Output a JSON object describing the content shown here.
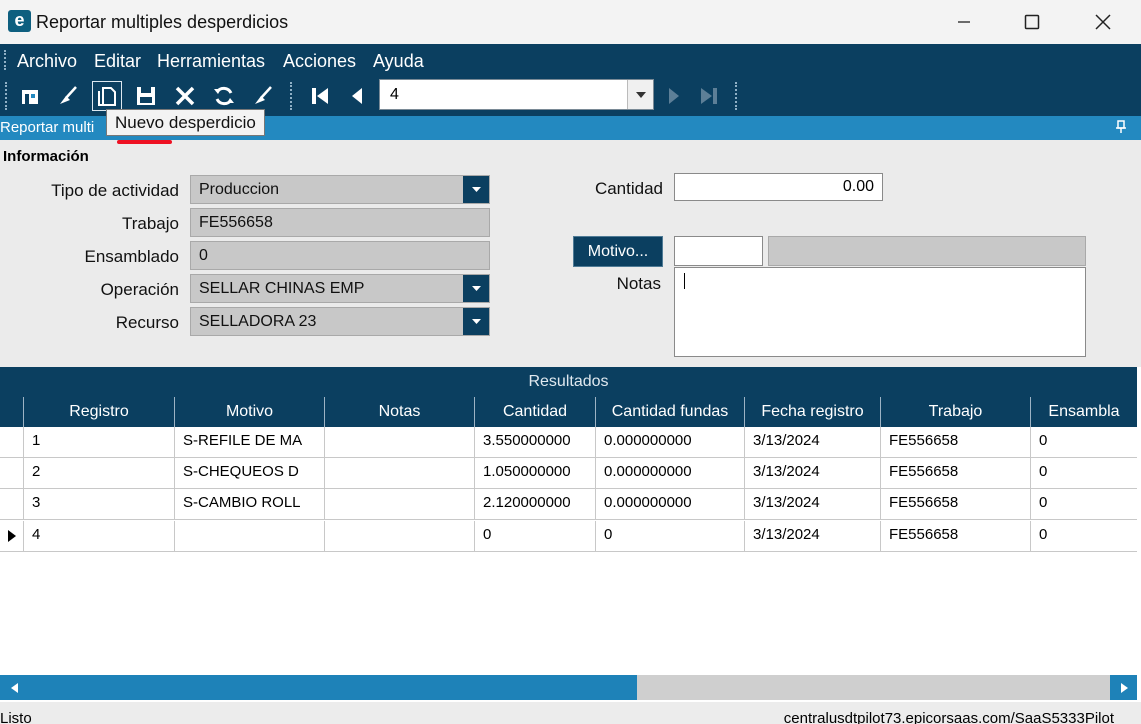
{
  "window": {
    "title": "Reportar multiples desperdicios",
    "app_icon_letter": "e"
  },
  "menu": [
    "Archivo",
    "Editar",
    "Herramientas",
    "Acciones",
    "Ayuda"
  ],
  "toolbar": {
    "record_value": "4",
    "tooltip": "Nuevo desperdicio"
  },
  "panel": {
    "caption": "Reportar multi"
  },
  "form": {
    "group_title": "Información",
    "tipo_actividad": {
      "label": "Tipo de actividad",
      "value": "Produccion"
    },
    "trabajo": {
      "label": "Trabajo",
      "value": "FE556658"
    },
    "ensamblado": {
      "label": "Ensamblado",
      "value": "0"
    },
    "operacion": {
      "label": "Operación",
      "value": "SELLAR CHINAS EMP"
    },
    "recurso": {
      "label": "Recurso",
      "value": "SELLADORA 23"
    },
    "cantidad": {
      "label": "Cantidad",
      "value": "0.00"
    },
    "motivo": {
      "button_label": "Motivo...",
      "code": "",
      "description": ""
    },
    "notas": {
      "label": "Notas",
      "value": ""
    }
  },
  "results": {
    "title": "Resultados",
    "columns": [
      "Registro",
      "Motivo",
      "Notas",
      "Cantidad",
      "Cantidad fundas",
      "Fecha registro",
      "Trabajo",
      "Ensambla"
    ],
    "rows": [
      {
        "registro": "1",
        "motivo": "S-REFILE DE MA",
        "notas": "",
        "cantidad": "3.550000000",
        "cantidad_fundas": "0.000000000",
        "fecha": "3/13/2024",
        "trabajo": "FE556658",
        "ensamblado": "0"
      },
      {
        "registro": "2",
        "motivo": "S-CHEQUEOS D",
        "notas": "",
        "cantidad": "1.050000000",
        "cantidad_fundas": "0.000000000",
        "fecha": "3/13/2024",
        "trabajo": "FE556658",
        "ensamblado": "0"
      },
      {
        "registro": "3",
        "motivo": "S-CAMBIO ROLL",
        "notas": "",
        "cantidad": "2.120000000",
        "cantidad_fundas": "0.000000000",
        "fecha": "3/13/2024",
        "trabajo": "FE556658",
        "ensamblado": "0"
      },
      {
        "registro": "4",
        "motivo": "",
        "notas": "",
        "cantidad": "0",
        "cantidad_fundas": "0",
        "fecha": "3/13/2024",
        "trabajo": "FE556658",
        "ensamblado": "0"
      }
    ],
    "current_row_indicator": "4"
  },
  "status": {
    "left": "Listo",
    "right": "centralusdtpilot73.epicorsaas.com/SaaS5333Pilot"
  },
  "colors": {
    "navy": "#0b3f60",
    "accent_blue": "#2389c0",
    "field_gray": "#c8c8c8"
  }
}
